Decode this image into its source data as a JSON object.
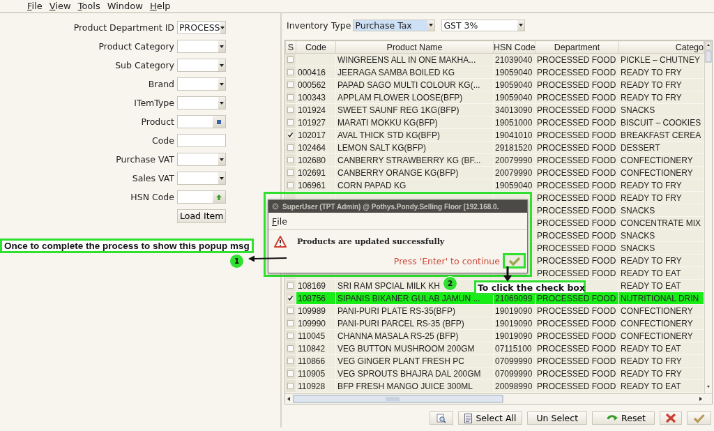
{
  "menu": [
    {
      "label": "File",
      "mnemonic": true
    },
    {
      "label": "View",
      "mnemonic": true
    },
    {
      "label": "Tools",
      "mnemonic": true
    },
    {
      "label": "Window",
      "mnemonic": false
    },
    {
      "label": "Help",
      "mnemonic": true
    }
  ],
  "form": {
    "fields": [
      {
        "label": "Product Department ID",
        "kind": "dropdown",
        "value": "PROCESS"
      },
      {
        "label": "Product Category",
        "kind": "dropdown"
      },
      {
        "label": "Sub Category",
        "kind": "dropdown"
      },
      {
        "label": "Brand",
        "kind": "dropdown"
      },
      {
        "label": "ITemType",
        "kind": "dropdown"
      },
      {
        "label": "Product",
        "kind": "lookup"
      },
      {
        "label": "Code",
        "kind": "text"
      },
      {
        "label": "Purchase VAT",
        "kind": "dropdown"
      },
      {
        "label": "Sales VAT",
        "kind": "dropdown"
      },
      {
        "label": "HSN Code",
        "kind": "hsn-lookup"
      }
    ],
    "load_button": "Load Item"
  },
  "inventory_type": {
    "label": "Inventory Type",
    "value": "Purchase Tax",
    "tax": "GST 3%"
  },
  "table": {
    "columns": [
      "S",
      "Code",
      "Product Name",
      "HSN Code",
      "Department",
      "Catego"
    ],
    "rows": [
      {
        "checked": false,
        "selected": false,
        "name": "WINGREENS ALL IN ONE MAKHA...",
        "hsn": "21039040",
        "department": "PROCESSED FOOD",
        "category": "PICKLE – CHUTNEY"
      },
      {
        "checked": false,
        "selected": false,
        "code": "000416",
        "name": "JEERAGA SAMBA BOILED KG",
        "hsn": "19059040",
        "department": "PROCESSED FOOD",
        "category": "READY TO FRY"
      },
      {
        "checked": false,
        "selected": false,
        "code": "000562",
        "name": "PAPAD SAGO MULTI COLOUR KG(...",
        "hsn": "19059040",
        "department": "PROCESSED FOOD",
        "category": "READY TO FRY"
      },
      {
        "checked": false,
        "selected": false,
        "code": "100343",
        "name": "APPLAM FLOWER LOOSE(BFP)",
        "hsn": "19059040",
        "department": "PROCESSED FOOD",
        "category": "READY TO FRY"
      },
      {
        "checked": false,
        "selected": false,
        "code": "101924",
        "name": "SWEET SAUNF REG 1KG(BFP)",
        "hsn": "34013090",
        "department": "PROCESSED FOOD",
        "category": "SNACKS"
      },
      {
        "checked": false,
        "selected": false,
        "code": "101927",
        "name": "MARATI MOKKU KG(BFP)",
        "hsn": "19051000",
        "department": "PROCESSED FOOD",
        "category": "BISCUIT – COOKIES"
      },
      {
        "checked": true,
        "selected": false,
        "code": "102017",
        "name": "AVAL THICK STD KG(BFP)",
        "hsn": "19041010",
        "department": "PROCESSED FOOD",
        "category": "BREAKFAST CEREA"
      },
      {
        "checked": false,
        "selected": false,
        "code": "102464",
        "name": "LEMON SALT KG(BFP)",
        "hsn": "29181520",
        "department": "PROCESSED FOOD",
        "category": "DESSERT"
      },
      {
        "checked": false,
        "selected": false,
        "code": "102680",
        "name": "CANBERRY STRAWBERRY KG (BF...",
        "hsn": "20079990",
        "department": "PROCESSED FOOD",
        "category": "CONFECTIONERY"
      },
      {
        "checked": false,
        "selected": false,
        "code": "102691",
        "name": "CANBERRY ORANGE KG(BFP)",
        "hsn": "20079990",
        "department": "PROCESSED FOOD",
        "category": "CONFECTIONERY"
      },
      {
        "checked": false,
        "selected": false,
        "code": "106961",
        "name": "CORN  PAPAD KG",
        "hsn": "19059040",
        "department": "PROCESSED FOOD",
        "category": "READY TO FRY"
      },
      {
        "selected": false,
        "department": "PROCESSED FOOD",
        "category": "READY TO FRY"
      },
      {
        "selected": false,
        "department": "PROCESSED FOOD",
        "category": "SNACKS"
      },
      {
        "selected": false,
        "department": "PROCESSED FOOD",
        "category": "CONCENTRATE MIX"
      },
      {
        "selected": false,
        "department": "PROCESSED FOOD",
        "category": "SNACKS"
      },
      {
        "selected": false,
        "department": "PROCESSED FOOD",
        "category": "SNACKS"
      },
      {
        "selected": false,
        "department": "PROCESSED FOOD",
        "category": "READY TO FRY"
      },
      {
        "selected": false,
        "department": "PROCESSED FOOD",
        "category": "READY TO EAT"
      },
      {
        "checked": false,
        "selected": false,
        "code": "108169",
        "name": "SRI RAM SPCIAL MILK KH",
        "category": "READY TO EAT"
      },
      {
        "checked": true,
        "selected": true,
        "code": "108756",
        "name": "SIPANIS BIKANER GULAB JAMUN ...",
        "hsn": "21069099",
        "department": "PROCESSED FOOD",
        "category": "NUTRITIONAL DRIN"
      },
      {
        "checked": false,
        "selected": false,
        "code": "109989",
        "name": "PANI-PURI PLATE RS-35(BFP)",
        "hsn": "19019090",
        "department": "PROCESSED FOOD",
        "category": "CONFECTIONERY"
      },
      {
        "checked": false,
        "selected": false,
        "code": "109990",
        "name": "PANI-PURI PARCEL RS-35 (BFP)",
        "hsn": "19019090",
        "department": "PROCESSED FOOD",
        "category": "CONFECTIONERY"
      },
      {
        "checked": false,
        "selected": false,
        "code": "110045",
        "name": "CHANNA MASALA RS-25 (BFP)",
        "hsn": "19019090",
        "department": "PROCESSED FOOD",
        "category": "CONFECTIONERY"
      },
      {
        "checked": false,
        "selected": false,
        "code": "110842",
        "name": "VEG  BUTTON MUSHROOM 200GM",
        "hsn": "07115100",
        "department": "PROCESSED FOOD",
        "category": "READY TO EAT"
      },
      {
        "checked": false,
        "selected": false,
        "code": "110866",
        "name": "VEG GINGER PLANT FRESH PC",
        "hsn": "07099990",
        "department": "PROCESSED FOOD",
        "category": "READY TO FRY"
      },
      {
        "checked": false,
        "selected": false,
        "code": "110905",
        "name": "VEG SPROUTS BHAJRA DAL 200GM",
        "hsn": "07099990",
        "department": "PROCESSED FOOD",
        "category": "READY TO FRY"
      },
      {
        "checked": false,
        "selected": false,
        "code": "110928",
        "name": "BFP FRESH MANGO JUICE 300ML",
        "hsn": "20098990",
        "department": "PROCESSED FOOD",
        "category": "READY TO EAT"
      }
    ]
  },
  "buttons": [
    {
      "kind": "preview"
    },
    {
      "kind": "select-all",
      "label": "Select All"
    },
    {
      "kind": "unselect",
      "label": "Un Select"
    },
    {
      "kind": "reset",
      "label": "Reset"
    },
    {
      "kind": "cancel"
    },
    {
      "kind": "ok"
    }
  ],
  "popup": {
    "title": "SuperUser (TPT Admin) @ Pothys.Pondy.Selling Floor [192.168.0.",
    "menu": "File",
    "message": "Products are updated successfully",
    "hint": "Press 'Enter' to continue"
  },
  "annotations": [
    {
      "number": "1",
      "text": "Once to complete the process to show this popup msg"
    },
    {
      "number": "2",
      "text": "To click the check box"
    }
  ]
}
